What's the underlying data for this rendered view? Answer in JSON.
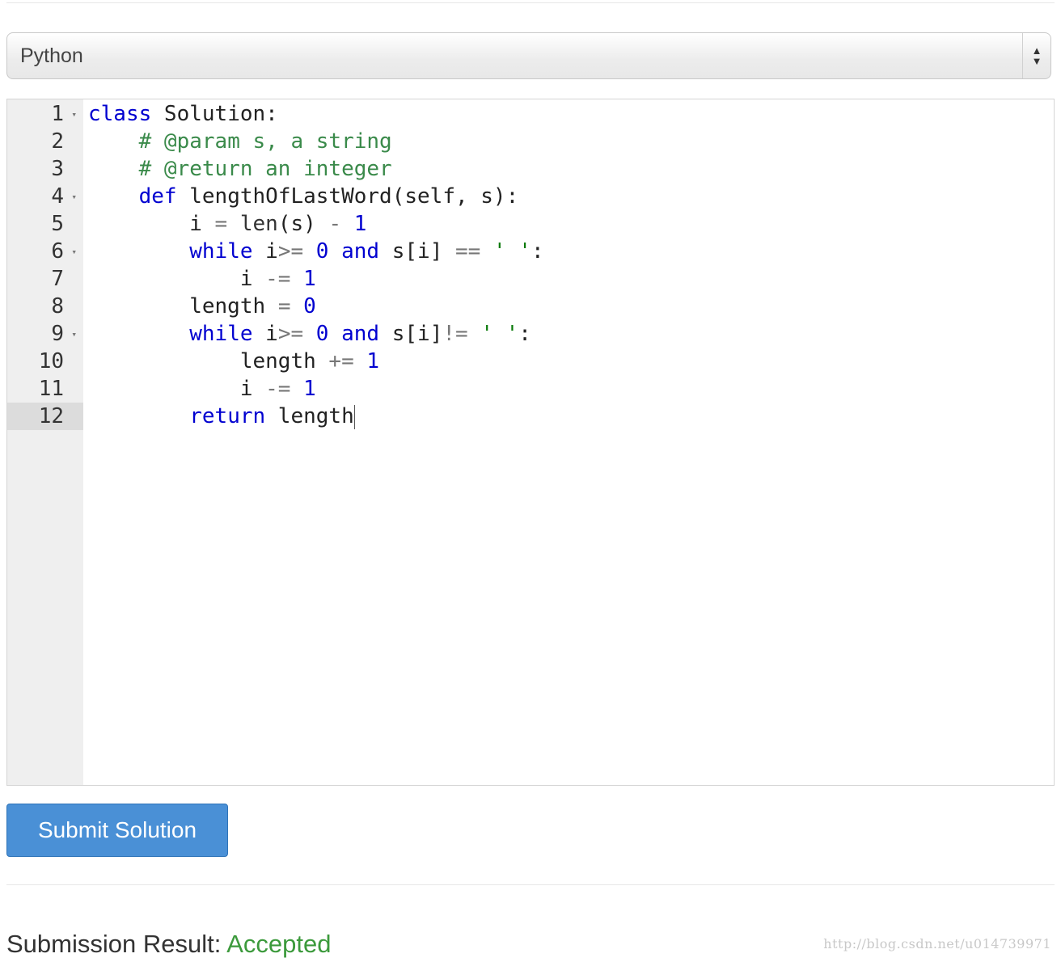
{
  "language_select": {
    "selected": "Python"
  },
  "editor": {
    "active_line": 12,
    "lines": [
      {
        "num": "1",
        "foldable": true
      },
      {
        "num": "2",
        "foldable": false
      },
      {
        "num": "3",
        "foldable": false
      },
      {
        "num": "4",
        "foldable": true
      },
      {
        "num": "5",
        "foldable": false
      },
      {
        "num": "6",
        "foldable": true
      },
      {
        "num": "7",
        "foldable": false
      },
      {
        "num": "8",
        "foldable": false
      },
      {
        "num": "9",
        "foldable": true
      },
      {
        "num": "10",
        "foldable": false
      },
      {
        "num": "11",
        "foldable": false
      },
      {
        "num": "12",
        "foldable": false
      }
    ],
    "code": [
      [
        [
          "kw",
          "class"
        ],
        [
          "t",
          " Solution:"
        ]
      ],
      [
        [
          "t",
          "    "
        ],
        [
          "cm",
          "# @param s, a string"
        ]
      ],
      [
        [
          "t",
          "    "
        ],
        [
          "cm",
          "# @return an integer"
        ]
      ],
      [
        [
          "t",
          "    "
        ],
        [
          "kw",
          "def"
        ],
        [
          "t",
          " lengthOfLastWord(self, s):"
        ]
      ],
      [
        [
          "t",
          "        i "
        ],
        [
          "op",
          "="
        ],
        [
          "t",
          " "
        ],
        [
          "fn",
          "len"
        ],
        [
          "t",
          "(s) "
        ],
        [
          "op",
          "-"
        ],
        [
          "t",
          " "
        ],
        [
          "num",
          "1"
        ]
      ],
      [
        [
          "t",
          "        "
        ],
        [
          "kw",
          "while"
        ],
        [
          "t",
          " i"
        ],
        [
          "op",
          ">="
        ],
        [
          "t",
          " "
        ],
        [
          "num",
          "0"
        ],
        [
          "t",
          " "
        ],
        [
          "kw",
          "and"
        ],
        [
          "t",
          " s[i] "
        ],
        [
          "op",
          "=="
        ],
        [
          "t",
          " "
        ],
        [
          "str",
          "' '"
        ],
        [
          "t",
          ":"
        ]
      ],
      [
        [
          "t",
          "            i "
        ],
        [
          "op",
          "-="
        ],
        [
          "t",
          " "
        ],
        [
          "num",
          "1"
        ]
      ],
      [
        [
          "t",
          "        length "
        ],
        [
          "op",
          "="
        ],
        [
          "t",
          " "
        ],
        [
          "num",
          "0"
        ]
      ],
      [
        [
          "t",
          "        "
        ],
        [
          "kw",
          "while"
        ],
        [
          "t",
          " i"
        ],
        [
          "op",
          ">="
        ],
        [
          "t",
          " "
        ],
        [
          "num",
          "0"
        ],
        [
          "t",
          " "
        ],
        [
          "kw",
          "and"
        ],
        [
          "t",
          " s[i]"
        ],
        [
          "op",
          "!="
        ],
        [
          "t",
          " "
        ],
        [
          "str",
          "' '"
        ],
        [
          "t",
          ":"
        ]
      ],
      [
        [
          "t",
          "            length "
        ],
        [
          "op",
          "+="
        ],
        [
          "t",
          " "
        ],
        [
          "num",
          "1"
        ]
      ],
      [
        [
          "t",
          "            i "
        ],
        [
          "op",
          "-="
        ],
        [
          "t",
          " "
        ],
        [
          "num",
          "1"
        ]
      ],
      [
        [
          "t",
          "        "
        ],
        [
          "kw",
          "return"
        ],
        [
          "t",
          " length"
        ]
      ]
    ]
  },
  "submit": {
    "label": "Submit Solution"
  },
  "result": {
    "label": "Submission Result: ",
    "status": "Accepted"
  },
  "watermark": {
    "text": "http://blog.csdn.net/u014739971"
  },
  "icons": {
    "select_arrows": "up-down-arrows-icon",
    "fold": "fold-arrow-icon"
  },
  "colors": {
    "keyword": "#0000d0",
    "comment": "#3a8a4a",
    "string": "#0a7a0a",
    "accepted": "#3c9a3c",
    "button": "#4a90d6"
  }
}
